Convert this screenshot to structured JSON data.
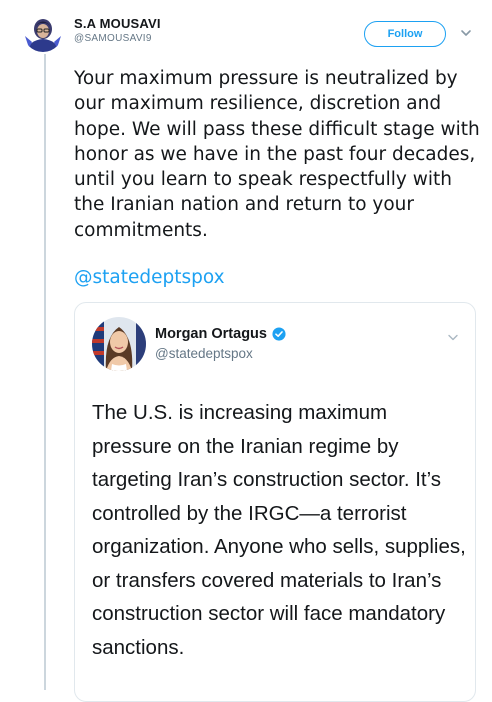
{
  "tweet": {
    "author_name": "S.A MOUSAVI",
    "author_handle": "@SAMOUSAVI9",
    "follow_label": "Follow",
    "avatar_icon": "profile-avatar-icon",
    "menu_icon": "chevron-down-icon",
    "text": "Your maximum pressure is neutralized by our maximum resilience, discretion and hope. We will pass these difficult stage with honor as we have in the past four decades, until you learn to speak respectfully with the Iranian nation and return to your commitments.",
    "mention": "@statedeptspox"
  },
  "quoted_tweet": {
    "author_name": "Morgan Ortagus",
    "author_handle": "@statedeptspox",
    "verified_icon": "verified-badge-icon",
    "menu_icon": "chevron-down-icon",
    "text": "The U.S. is increasing maximum pressure on the Iranian regime by targeting Iran’s construction sector. It’s controlled by the IRGC—a terrorist organization. Anyone who sells, supplies, or transfers covered materials to Iran’s construction sector will face mandatory sanctions."
  },
  "colors": {
    "accent": "#1da1f2",
    "text": "#14171a",
    "secondary_text": "#657786",
    "border": "#e1e8ed"
  }
}
